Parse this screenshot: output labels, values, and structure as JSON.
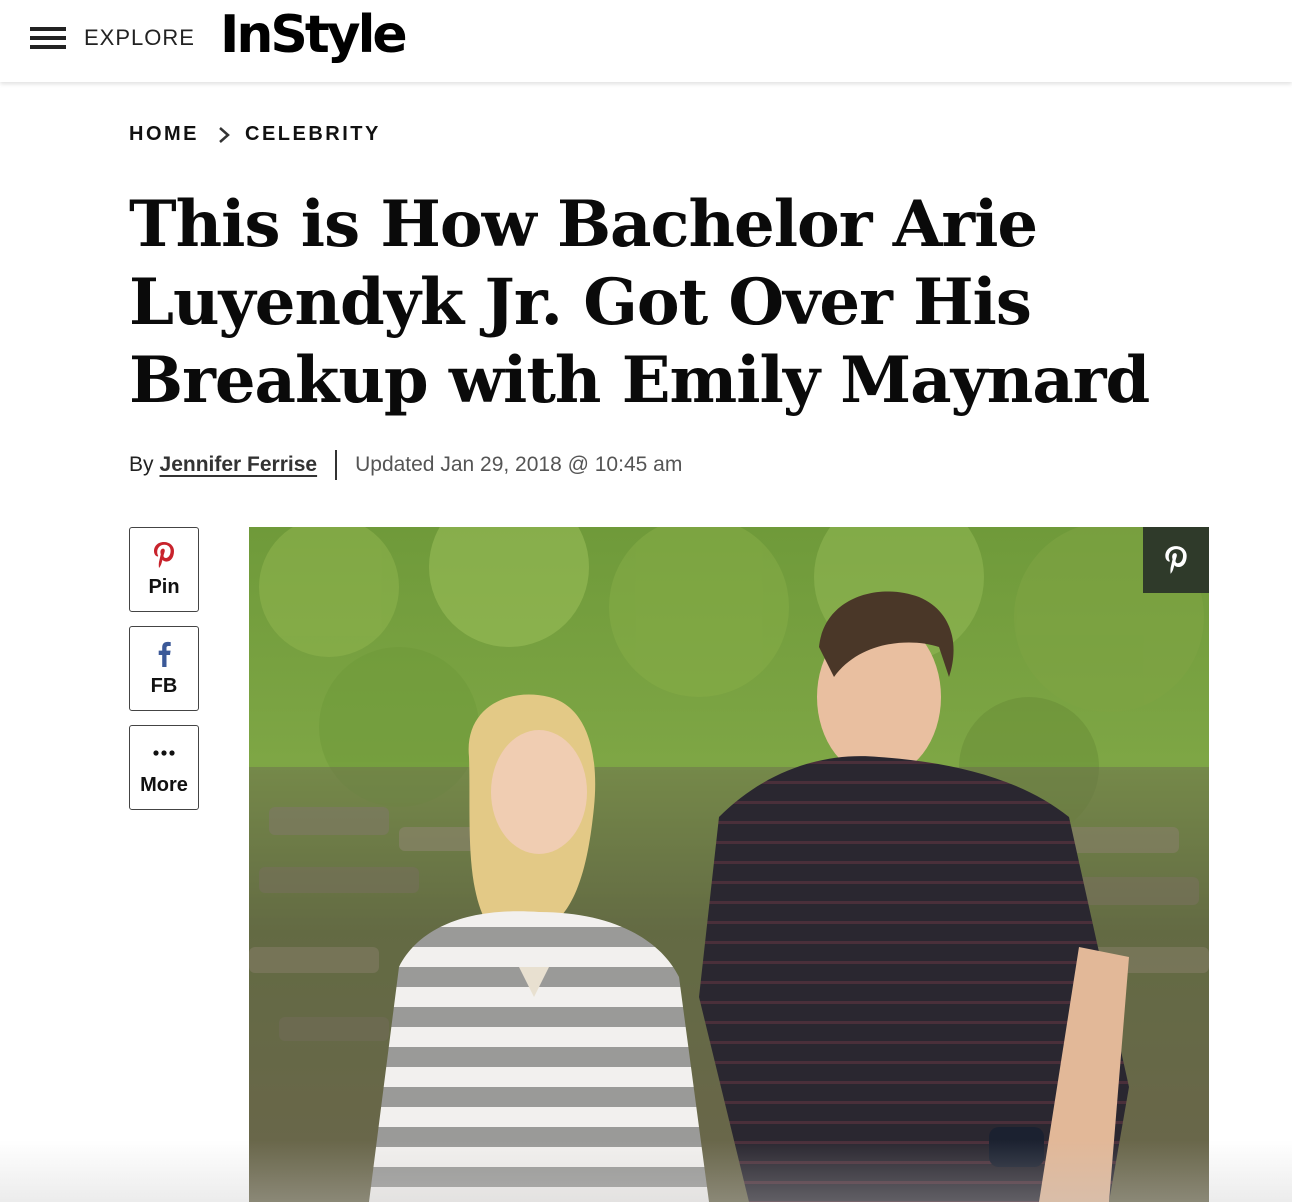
{
  "header": {
    "menu_label": "EXPLORE",
    "logo_text": "InStyle"
  },
  "breadcrumb": {
    "items": [
      "HOME",
      "CELEBRITY"
    ]
  },
  "article": {
    "title": "This is How Bachelor Arie Luyendyk Jr. Got Over His Breakup with Emily Maynard",
    "byline_prefix": "By",
    "author": "Jennifer Ferrise",
    "updated": "Updated Jan 29, 2018 @ 10:45 am"
  },
  "share": {
    "pin_label": "Pin",
    "fb_label": "FB",
    "more_label": "More"
  },
  "colors": {
    "pinterest": "#c8232c",
    "facebook": "#3b5998",
    "pin_overlay_bg": "#2f3a2a"
  },
  "hero_image": {
    "icon": "pinterest-save-icon"
  }
}
